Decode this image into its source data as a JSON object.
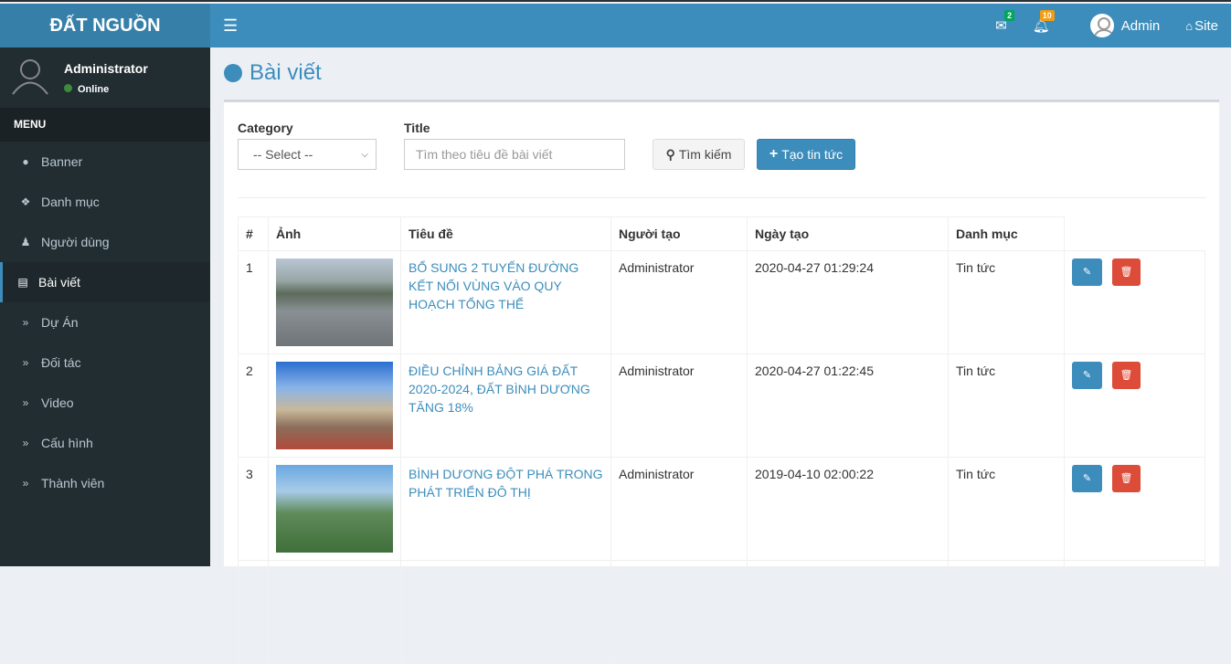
{
  "brand": "ĐẤT NGUỒN",
  "header": {
    "mail_count": "2",
    "notif_count": "10",
    "user": "Admin",
    "site": "Site",
    "colors": {
      "mail_badge": "#00a65a",
      "notif_badge": "#f39c12"
    }
  },
  "sidebar": {
    "user_name": "Administrator",
    "status": "Online",
    "menu_header": "MENU",
    "items": [
      {
        "label": "Banner",
        "icon": "circle-icon"
      },
      {
        "label": "Danh mục",
        "icon": "tags-icon"
      },
      {
        "label": "Người dùng",
        "icon": "users-icon"
      },
      {
        "label": "Bài viết",
        "icon": "newspaper-icon",
        "active": true
      },
      {
        "label": "Dự Án",
        "icon": "double-chevron-icon"
      },
      {
        "label": "Đối tác",
        "icon": "double-chevron-icon"
      },
      {
        "label": "Video",
        "icon": "double-chevron-icon"
      },
      {
        "label": "Cấu hình",
        "icon": "double-chevron-icon"
      },
      {
        "label": "Thành viên",
        "icon": "double-chevron-icon"
      }
    ]
  },
  "page": {
    "title": "Bài viết"
  },
  "filters": {
    "category_label": "Category",
    "category_value": "-- Select --",
    "title_label": "Title",
    "title_placeholder": "Tìm theo tiêu đề bài viết",
    "search_button": "Tìm kiếm",
    "create_button": "Tạo tin tức"
  },
  "table": {
    "headers": [
      "#",
      "Ảnh",
      "Tiêu đề",
      "Người tạo",
      "Ngày tạo",
      "Danh mục"
    ],
    "rows": [
      {
        "no": "1",
        "title": "BỔ SUNG 2 TUYẾN ĐƯỜNG KẾT NỐI VÙNG VÀO QUY HOẠCH TỔNG THỂ",
        "author": "Administrator",
        "date": "2020-04-27 01:29:24",
        "category": "Tin tức"
      },
      {
        "no": "2",
        "title": "ĐIỀU CHỈNH BẢNG GIÁ ĐẤT 2020-2024, ĐẤT BÌNH DƯƠNG TĂNG 18%",
        "author": "Administrator",
        "date": "2020-04-27 01:22:45",
        "category": "Tin tức"
      },
      {
        "no": "3",
        "title": "BÌNH DƯƠNG ĐỘT PHÁ TRONG PHÁT TRIỂN ĐÔ THỊ",
        "author": "Administrator",
        "date": "2019-04-10 02:00:22",
        "category": "Tin tức"
      }
    ]
  }
}
